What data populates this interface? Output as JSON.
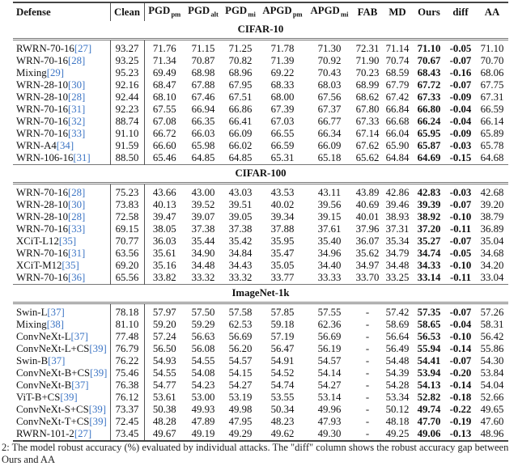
{
  "columns": [
    "Defense",
    "Clean",
    "PGD|pm",
    "PGD|alt",
    "PGD|mi",
    "APGD|pm",
    "APGD|mi",
    "FAB",
    "MD",
    "Ours",
    "diff",
    "AA"
  ],
  "colors": {
    "citation": "#3b74c4",
    "text": "#111111"
  },
  "sections": [
    {
      "title": "CIFAR-10",
      "rows": [
        {
          "model": "RWRN-70-16",
          "cite": "27",
          "values": [
            "93.27",
            "71.76",
            "71.15",
            "71.25",
            "71.78",
            "71.30",
            "72.31",
            "71.14",
            "71.10",
            "-0.05",
            "71.10"
          ]
        },
        {
          "model": "WRN-70-16",
          "cite": "28",
          "values": [
            "93.25",
            "71.34",
            "70.87",
            "70.82",
            "71.39",
            "70.92",
            "71.90",
            "70.74",
            "70.67",
            "-0.07",
            "70.70"
          ]
        },
        {
          "model": "Mixing",
          "cite": "29",
          "values": [
            "95.23",
            "69.49",
            "68.98",
            "68.96",
            "69.22",
            "70.43",
            "70.23",
            "68.59",
            "68.43",
            "-0.16",
            "68.06"
          ]
        },
        {
          "model": "WRN-28-10",
          "cite": "30",
          "values": [
            "92.16",
            "68.47",
            "67.88",
            "67.95",
            "68.33",
            "68.03",
            "68.99",
            "67.79",
            "67.72",
            "-0.07",
            "67.75"
          ]
        },
        {
          "model": "WRN-28-10",
          "cite": "28",
          "values": [
            "92.44",
            "68.10",
            "67.46",
            "67.51",
            "68.00",
            "67.56",
            "68.62",
            "67.42",
            "67.33",
            "-0.09",
            "67.31"
          ]
        },
        {
          "model": "WRN-70-16",
          "cite": "31",
          "values": [
            "92.23",
            "67.55",
            "66.94",
            "66.86",
            "67.39",
            "67.37",
            "67.80",
            "66.84",
            "66.80",
            "-0.04",
            "66.59"
          ]
        },
        {
          "model": "WRN-70-16",
          "cite": "32",
          "values": [
            "88.74",
            "67.08",
            "66.35",
            "66.41",
            "67.03",
            "66.77",
            "67.33",
            "66.68",
            "66.24",
            "-0.04",
            "66.14"
          ]
        },
        {
          "model": "WRN-70-16",
          "cite": "33",
          "values": [
            "91.10",
            "66.72",
            "66.03",
            "66.09",
            "66.55",
            "66.34",
            "67.14",
            "66.04",
            "65.95",
            "-0.09",
            "65.89"
          ]
        },
        {
          "model": "WRN-A4",
          "cite": "34",
          "values": [
            "91.59",
            "66.60",
            "65.98",
            "66.02",
            "66.59",
            "66.09",
            "67.62",
            "65.90",
            "65.87",
            "-0.03",
            "65.78"
          ]
        },
        {
          "model": "WRN-106-16",
          "cite": "31",
          "values": [
            "88.50",
            "65.46",
            "64.85",
            "64.85",
            "65.31",
            "65.18",
            "65.62",
            "64.84",
            "64.69",
            "-0.15",
            "64.68"
          ]
        }
      ]
    },
    {
      "title": "CIFAR-100",
      "rows": [
        {
          "model": "WRN-70-16",
          "cite": "28",
          "values": [
            "75.23",
            "43.66",
            "43.00",
            "43.03",
            "43.53",
            "43.11",
            "43.89",
            "42.86",
            "42.83",
            "-0.03",
            "42.68"
          ]
        },
        {
          "model": "WRN-28-10",
          "cite": "30",
          "values": [
            "73.83",
            "40.13",
            "39.52",
            "39.51",
            "40.02",
            "39.56",
            "40.69",
            "39.46",
            "39.39",
            "-0.07",
            "39.20"
          ]
        },
        {
          "model": "WRN-28-10",
          "cite": "28",
          "values": [
            "72.58",
            "39.47",
            "39.07",
            "39.05",
            "39.34",
            "39.15",
            "40.01",
            "38.93",
            "38.92",
            "-0.10",
            "38.79"
          ]
        },
        {
          "model": "WRN-70-16",
          "cite": "33",
          "values": [
            "69.15",
            "38.05",
            "37.38",
            "37.38",
            "37.88",
            "37.61",
            "37.96",
            "37.31",
            "37.20",
            "-0.11",
            "36.89"
          ]
        },
        {
          "model": "XCiT-L12",
          "cite": "35",
          "values": [
            "70.77",
            "36.03",
            "35.44",
            "35.42",
            "35.95",
            "35.40",
            "36.07",
            "35.34",
            "35.27",
            "-0.07",
            "35.04"
          ]
        },
        {
          "model": "WRN-70-16",
          "cite": "31",
          "values": [
            "63.56",
            "35.61",
            "34.90",
            "34.84",
            "35.47",
            "34.96",
            "35.62",
            "34.79",
            "34.74",
            "-0.05",
            "34.68"
          ]
        },
        {
          "model": "XCiT-M12",
          "cite": "35",
          "values": [
            "69.20",
            "35.16",
            "34.48",
            "34.43",
            "35.05",
            "34.40",
            "34.97",
            "34.48",
            "34.33",
            "-0.10",
            "34.20"
          ]
        },
        {
          "model": "WRN-70-16",
          "cite": "36",
          "values": [
            "65.56",
            "33.82",
            "33.32",
            "33.32",
            "33.77",
            "33.33",
            "33.70",
            "33.25",
            "33.14",
            "-0.11",
            "33.04"
          ]
        }
      ]
    },
    {
      "title": "ImageNet-1k",
      "rows": [
        {
          "model": "Swin-L",
          "cite": "37",
          "values": [
            "78.18",
            "57.97",
            "57.50",
            "57.58",
            "57.85",
            "57.55",
            "-",
            "57.42",
            "57.35",
            "-0.07",
            "57.26"
          ]
        },
        {
          "model": "Mixing",
          "cite": "38",
          "values": [
            "81.10",
            "59.20",
            "59.29",
            "62.53",
            "59.18",
            "62.36",
            "-",
            "58.69",
            "58.65",
            "-0.04",
            "58.31"
          ]
        },
        {
          "model": "ConvNeXt-L",
          "cite": "37",
          "values": [
            "77.48",
            "57.24",
            "56.63",
            "56.69",
            "57.19",
            "56.69",
            "-",
            "56.64",
            "56.53",
            "-0.10",
            "56.42"
          ]
        },
        {
          "model": "ConvNeXt-L+CS",
          "cite": "39",
          "values": [
            "76.79",
            "56.50",
            "56.08",
            "56.20",
            "56.47",
            "56.19",
            "-",
            "56.49",
            "55.94",
            "-0.14",
            "55.86"
          ]
        },
        {
          "model": "Swin-B",
          "cite": "37",
          "values": [
            "76.22",
            "54.93",
            "54.55",
            "54.57",
            "54.91",
            "54.57",
            "-",
            "54.48",
            "54.41",
            "-0.07",
            "54.30"
          ]
        },
        {
          "model": "ConvNeXt-B+CS",
          "cite": "39",
          "values": [
            "75.46",
            "54.55",
            "54.08",
            "54.15",
            "54.52",
            "54.14",
            "-",
            "54.39",
            "53.94",
            "-0.20",
            "53.84"
          ]
        },
        {
          "model": "ConvNeXt-B",
          "cite": "37",
          "values": [
            "76.38",
            "54.77",
            "54.23",
            "54.27",
            "54.74",
            "54.27",
            "-",
            "54.28",
            "54.13",
            "-0.14",
            "54.04"
          ]
        },
        {
          "model": "ViT-B+CS",
          "cite": "39",
          "values": [
            "76.12",
            "53.61",
            "53.00",
            "53.19",
            "53.55",
            "53.14",
            "-",
            "53.34",
            "52.82",
            "-0.18",
            "52.66"
          ]
        },
        {
          "model": "ConvNeXt-S+CS",
          "cite": "39",
          "values": [
            "73.37",
            "50.38",
            "49.93",
            "49.98",
            "50.34",
            "49.96",
            "-",
            "50.12",
            "49.74",
            "-0.22",
            "49.65"
          ]
        },
        {
          "model": "ConvNeXt-T+CS",
          "cite": "39",
          "values": [
            "72.45",
            "48.28",
            "47.89",
            "47.95",
            "48.23",
            "47.93",
            "-",
            "48.18",
            "47.70",
            "-0.19",
            "47.60"
          ]
        },
        {
          "model": "RWRN-101-2",
          "cite": "27",
          "values": [
            "73.45",
            "49.67",
            "49.19",
            "49.29",
            "49.62",
            "49.30",
            "-",
            "49.25",
            "49.06",
            "-0.13",
            "48.96"
          ]
        }
      ]
    }
  ],
  "caption": "2: The model robust accuracy (%) evaluated by individual attacks. The \"diff\" column shows the robust accuracy gap between Ours and AA"
}
